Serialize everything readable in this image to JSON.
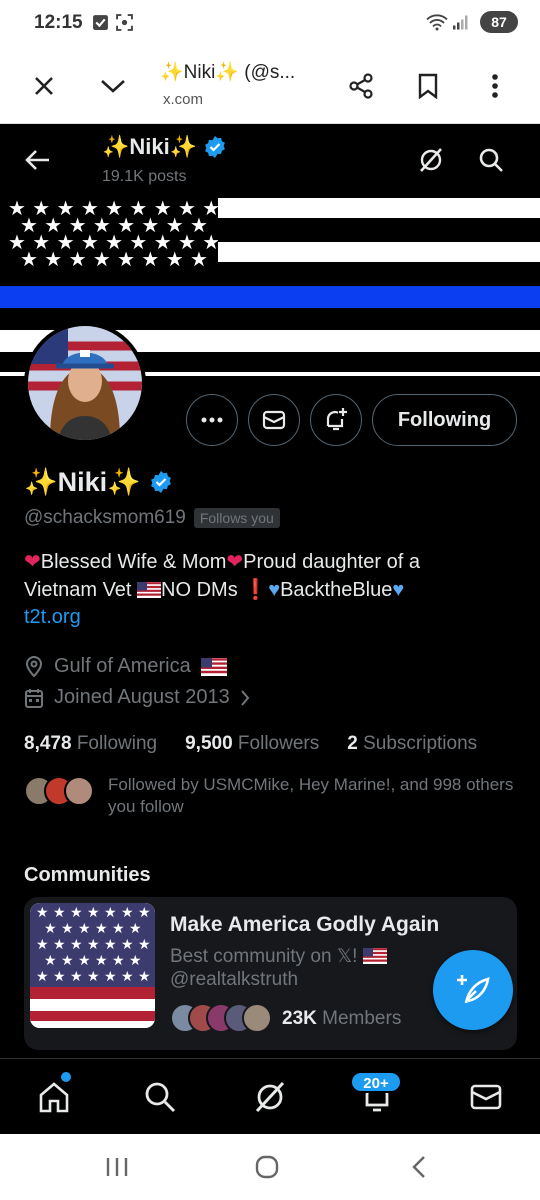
{
  "status_bar": {
    "time": "12:15",
    "battery": "87"
  },
  "browser": {
    "tab_title": "✨Niki✨ (@s...",
    "domain": "x.com"
  },
  "header": {
    "name": "✨Niki✨",
    "posts": "19.1K posts"
  },
  "profile": {
    "display_name": "✨Niki✨",
    "handle": "@schacksmom619",
    "follows_you": "Follows you",
    "bio_line1_a": "Blessed Wife & Mom",
    "bio_line1_b": "Proud daughter of a",
    "bio_line2_a": "Vietnam Vet",
    "bio_line2_b": "NO DMs",
    "bio_line2_c": "BacktheBlue",
    "link": "t2t.org",
    "location": "Gulf of America",
    "joined": "Joined August 2013",
    "following_count": "8,478",
    "following_label": "Following",
    "followers_count": "9,500",
    "followers_label": "Followers",
    "subscriptions_count": "2",
    "subscriptions_label": "Subscriptions",
    "followed_by": "Followed by USMCMike, Hey Marine!, and 998 others you follow",
    "following_button": "Following"
  },
  "communities": {
    "title": "Communities",
    "name": "Make America Godly Again",
    "description": "Best community on 𝕏!",
    "handle": "@realtalkstruth",
    "members_count": "23K",
    "members_label": "Members"
  },
  "bottom_nav": {
    "notifications_badge": "20+"
  },
  "colors": {
    "accent": "#1d9bf0",
    "background": "#000000",
    "card": "#16181c",
    "muted": "#71767b"
  }
}
